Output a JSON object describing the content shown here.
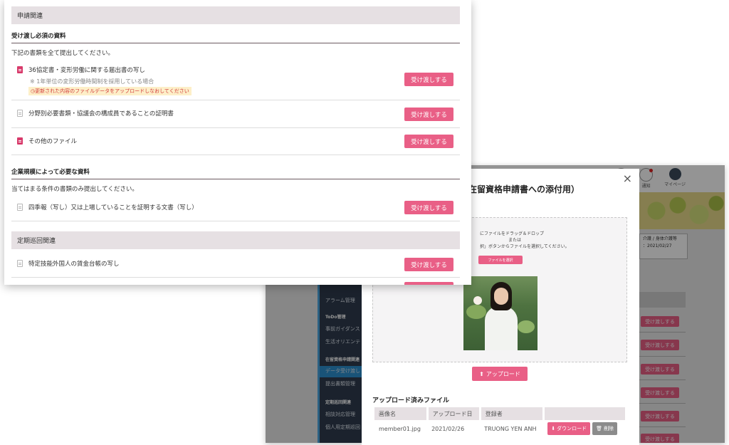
{
  "front": {
    "section1": {
      "title": "申請関連",
      "required": {
        "heading": "受け渡し必須の資料",
        "description": "下記の書類を全て提出してください。",
        "items": [
          {
            "name": "36協定書・変形労働に関する届出書の写し",
            "note": "※ 1年単位の変形労働時間制を採用している場合",
            "warning": "更新された内容のファイルデータをアップロードしなおしてください",
            "icon": "pdf-file-icon",
            "button": "受け渡しする"
          },
          {
            "name": "分野別必要書類・協議会の構成員であることの証明書",
            "icon": "file-icon",
            "button": "受け渡しする"
          },
          {
            "name": "その他のファイル",
            "icon": "pdf-file-icon",
            "button": "受け渡しする"
          }
        ]
      },
      "conditional": {
        "heading": "企業規模によって必要な資料",
        "description": "当てはまる条件の書類のみ提出してください。",
        "items": [
          {
            "name": "四季報（写し）又は上場していることを証明する文書（写し）",
            "icon": "file-icon",
            "button": "受け渡しする"
          }
        ]
      }
    },
    "section2": {
      "title": "定期巡回関連",
      "items": [
        {
          "name": "特定技能外国人の賃金台帳の写し",
          "icon": "file-icon",
          "button": "受け渡しする"
        }
      ]
    }
  },
  "modal": {
    "title": "在留資格申請書への添付用）",
    "close": "×",
    "dropzone": {
      "line1": "にファイルをドラッグ＆ドロップ",
      "line2": "または",
      "line3": "択」ボタンからファイルを選択してください。",
      "select_button": "ファイルを選択"
    },
    "upload_button": "アップロード",
    "uploaded_title": "アップロード済みファイル",
    "table": {
      "headers": [
        "画像名",
        "アップロード日",
        "登録者",
        ""
      ],
      "rows": [
        {
          "file": "member01.jpg",
          "date": "2021/02/26",
          "user": "TRUONG YEN ANH",
          "download": "ダウンロード",
          "delete": "削除"
        }
      ]
    }
  },
  "back": {
    "header_icons": [
      {
        "label": "ート",
        "icon": "help-icon"
      },
      {
        "label": "通知",
        "icon": "bell-icon"
      },
      {
        "label": "マイページ",
        "icon": "avatar-icon"
      }
    ],
    "info_box": {
      "line1": "介護 / 身体介護等",
      "line2": "：2021/02/27"
    },
    "sidebar": {
      "item_top": "アラーム管理",
      "group1": "ToDo管理",
      "group1_items": [
        "事前ガイダンス",
        "生活オリエンテ"
      ],
      "group2": "在留資格申請関連",
      "group2_items": [
        "データ受け渡し",
        "提出書類管理"
      ],
      "group3": "定期巡回関連",
      "group3_items": [
        "相談対応管理",
        "個人用定期巡回"
      ]
    },
    "buttons": [
      "受け渡しする",
      "受け渡しする",
      "受け渡しする",
      "受け渡しする",
      "受け渡しする",
      "受け渡しする",
      "受け渡しする"
    ]
  },
  "colors": {
    "accent": "#e95f86",
    "section_bg": "#e6e0e3",
    "sidebar_bg": "#2f3c4e",
    "sidebar_active": "#2b8fcf"
  }
}
